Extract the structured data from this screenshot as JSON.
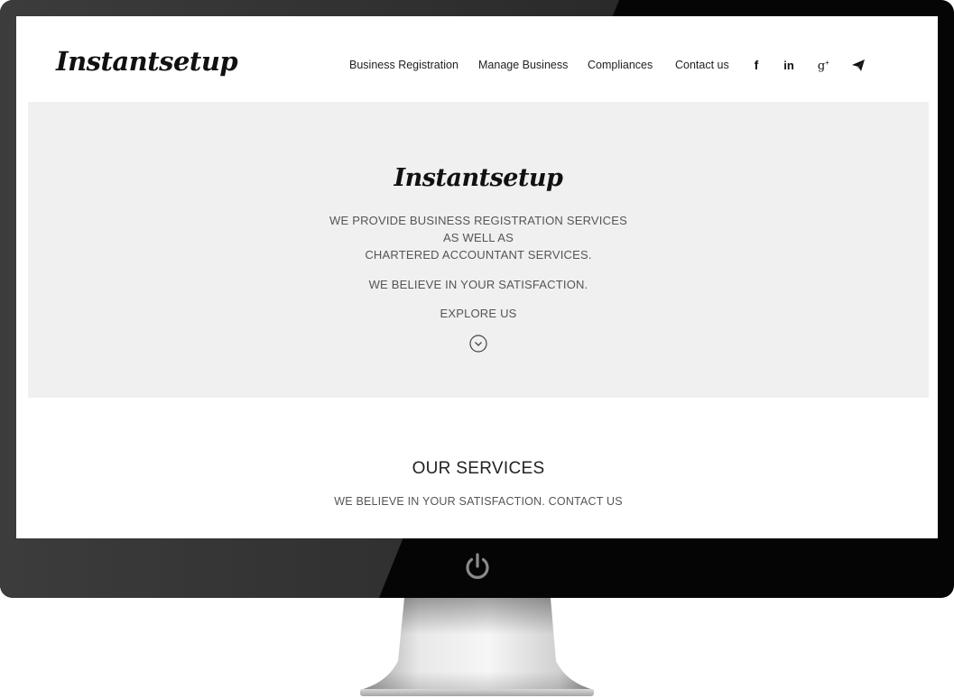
{
  "site": {
    "brand": "Instantsetup",
    "nav": [
      {
        "label": "Business Registration"
      },
      {
        "label": "Manage Business"
      },
      {
        "label": "Compliances"
      },
      {
        "label": "Contact us"
      }
    ],
    "social_icons": [
      "facebook-icon",
      "linkedin-icon",
      "google-plus-icon",
      "telegram-icon"
    ],
    "hero": {
      "logo": "Instantsetup",
      "line1": "WE PROVIDE BUSINESS REGISTRATION SERVICES",
      "line2": "AS WELL AS",
      "line3": "CHARTERED ACCOUNTANT SERVICES.",
      "tagline": "WE BELIEVE IN YOUR SATISFACTION.",
      "explore": "EXPLORE US"
    },
    "services": {
      "title": "OUR SERVICES",
      "subtitle": "WE BELIEVE IN YOUR SATISFACTION. CONTACT US"
    }
  },
  "colors": {
    "hero_bg": "#f0f0f0",
    "monitor": "#050505",
    "text": "#222222"
  }
}
